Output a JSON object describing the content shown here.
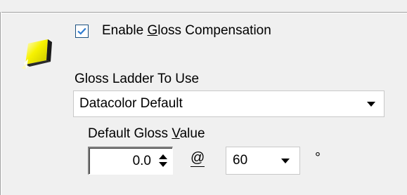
{
  "gloss": {
    "enable_label_pre": "Enable ",
    "enable_label_mnemonic": "G",
    "enable_label_post": "loss Compensation",
    "enable_checked": true,
    "ladder_label": "Gloss Ladder To Use",
    "ladder_value": "Datacolor Default",
    "default_label_pre": "Default Gloss ",
    "default_label_mnemonic": "V",
    "default_label_post": "alue",
    "default_value": "0.0",
    "at_symbol": "@",
    "angle_value": "60",
    "degree_symbol": "°",
    "icon": "gloss-card-icon"
  },
  "colors": {
    "checkbox_border": "#1c5180",
    "check_mark": "#2e7bd0",
    "icon_yellow": "#f5f000"
  }
}
